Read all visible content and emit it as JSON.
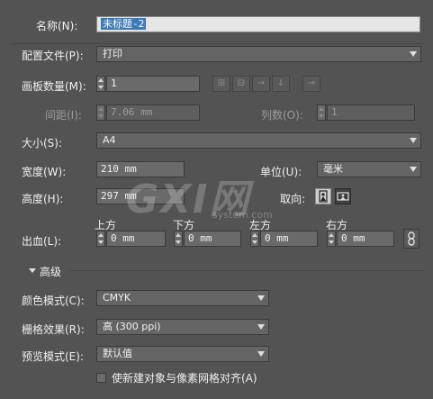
{
  "name": {
    "label": "名称(N):",
    "value": "未标题-2"
  },
  "profile": {
    "label": "配置文件(P):",
    "value": "打印"
  },
  "artboards": {
    "label": "画板数量(M):",
    "value": "1",
    "arrange_icons": [
      "grid-by-row-icon",
      "grid-by-column-icon",
      "arrange-by-row-icon",
      "arrange-by-column-icon",
      "right-to-left-icon"
    ]
  },
  "spacing": {
    "label": "间距(I):",
    "value": "7.06 mm"
  },
  "columns": {
    "label": "列数(O):",
    "value": "1"
  },
  "size": {
    "label": "大小(S):",
    "value": "A4"
  },
  "width": {
    "label": "宽度(W):",
    "value": "210 mm"
  },
  "units": {
    "label": "单位(U):",
    "value": "毫米"
  },
  "height": {
    "label": "高度(H):",
    "value": "297 mm"
  },
  "orientation": {
    "label": "取向:"
  },
  "bleed": {
    "label": "出血(L):",
    "top": {
      "label": "上方",
      "value": "0 mm"
    },
    "bottom": {
      "label": "下方",
      "value": "0 mm"
    },
    "left": {
      "label": "左方",
      "value": "0 mm"
    },
    "right": {
      "label": "右方",
      "value": "0 mm"
    }
  },
  "advanced": {
    "label": "高级"
  },
  "color_mode": {
    "label": "颜色模式(C):",
    "value": "CMYK"
  },
  "raster": {
    "label": "栅格效果(R):",
    "value": "高 (300 ppi)"
  },
  "preview": {
    "label": "预览模式(E):",
    "value": "默认值"
  },
  "align_pixel": {
    "label": "使新建对象与像素网格对齐(A)",
    "checked": false
  },
  "watermark": {
    "logo": "GXI网",
    "url": "system.com"
  },
  "colors": {
    "background": "#535353",
    "selection": "#3d7ab5",
    "field": "#6a6a6a"
  }
}
